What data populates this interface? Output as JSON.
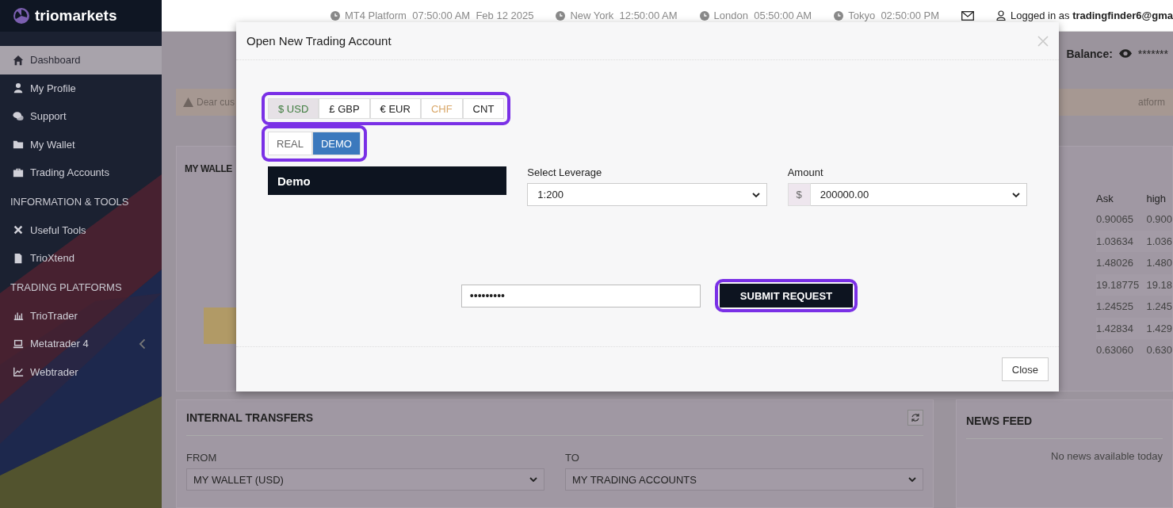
{
  "brand": {
    "name": "triomarkets"
  },
  "header": {
    "clocks": [
      {
        "label": "MT4 Platform",
        "time": "07:50:00 AM",
        "date": "Feb 12 2025"
      },
      {
        "label": "New York",
        "time": "12:50:00 AM"
      },
      {
        "label": "London",
        "time": "05:50:00 AM"
      },
      {
        "label": "Tokyo",
        "time": "02:50:00 PM"
      }
    ],
    "user": "Logged in as **tradingfinder6@gma**"
  },
  "sidebar": {
    "items": [
      {
        "kind": "item",
        "label": "Dashboard",
        "selected": true,
        "submenu": false
      },
      {
        "kind": "item",
        "label": "My Profile",
        "selected": false,
        "submenu": false
      },
      {
        "kind": "item",
        "label": "Support",
        "selected": false,
        "submenu": false
      },
      {
        "kind": "item",
        "label": "My Wallet",
        "selected": false,
        "submenu": false
      },
      {
        "kind": "item",
        "label": "Trading Accounts",
        "selected": false,
        "submenu": false
      },
      {
        "kind": "section",
        "label": "INFORMATION & TOOLS"
      },
      {
        "kind": "item",
        "label": "Useful Tools",
        "selected": false,
        "submenu": false
      },
      {
        "kind": "item",
        "label": "TrioXtend",
        "selected": false,
        "submenu": false
      },
      {
        "kind": "section",
        "label": "TRADING PLATFORMS"
      },
      {
        "kind": "item",
        "label": "TrioTrader",
        "selected": false,
        "submenu": false
      },
      {
        "kind": "item",
        "label": "Metatrader 4",
        "selected": false,
        "submenu": true
      },
      {
        "kind": "item",
        "label": "Webtrader",
        "selected": false,
        "submenu": false
      }
    ]
  },
  "balance": {
    "label": "Balance:",
    "value": "*******"
  },
  "alert": {
    "left_text": "Dear cus",
    "right_text": "atform"
  },
  "wallet_panel": {
    "title": "MY WALLE"
  },
  "rates_table": {
    "columns": [
      "Ask",
      "high"
    ],
    "rows": [
      [
        "0.90065",
        "0.900"
      ],
      [
        "1.03634",
        "1.036"
      ],
      [
        "1.48026",
        "1.480"
      ],
      [
        "19.18775",
        "19.18"
      ],
      [
        "1.24525",
        "1.245"
      ],
      [
        "1.42834",
        "1.429"
      ],
      [
        "0.63060",
        "0.630"
      ]
    ]
  },
  "transfers": {
    "title": "INTERNAL TRANSFERS",
    "from_label": "FROM",
    "from_value": "MY WALLET (USD)",
    "to_label": "TO",
    "to_value": "MY TRADING ACCOUNTS"
  },
  "news": {
    "title": "NEWS FEED",
    "empty_text": "No news available today"
  },
  "modal": {
    "title": "Open New Trading Account",
    "currency_group": {
      "highlighted": true,
      "options": [
        {
          "label": "$ USD",
          "selected": true,
          "disabled": false
        },
        {
          "label": "£ GBP",
          "selected": false,
          "disabled": false
        },
        {
          "label": "€ EUR",
          "selected": false,
          "disabled": false
        },
        {
          "label": "CHF",
          "selected": false,
          "disabled": true
        },
        {
          "label": "CNT",
          "selected": false,
          "disabled": false
        }
      ]
    },
    "type_group": {
      "highlighted": true,
      "options": [
        {
          "label": "REAL",
          "selected": false
        },
        {
          "label": "DEMO",
          "selected": true
        }
      ]
    },
    "account_banner": "Demo",
    "leverage": {
      "label": "Select Leverage",
      "value": "1:200"
    },
    "amount": {
      "label": "Amount",
      "prefix": "$",
      "value": "200000.00"
    },
    "password": {
      "value": "•••••••••"
    },
    "submit": {
      "label": "SUBMIT REQUEST",
      "highlighted": true
    },
    "close_button": "Close"
  }
}
